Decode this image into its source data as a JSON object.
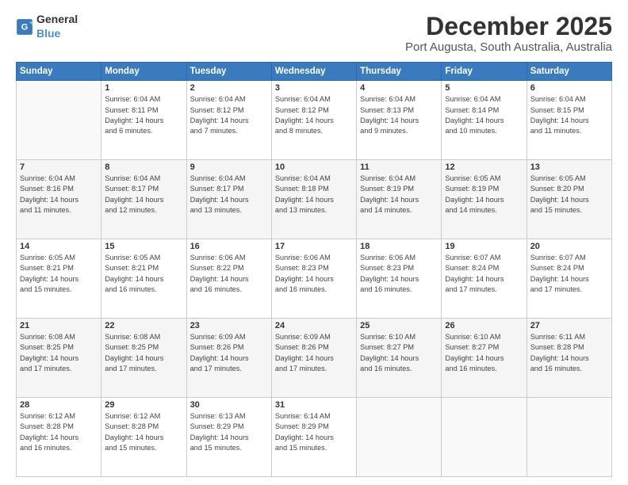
{
  "header": {
    "logo_general": "General",
    "logo_blue": "Blue",
    "main_title": "December 2025",
    "subtitle": "Port Augusta, South Australia, Australia"
  },
  "calendar": {
    "days_of_week": [
      "Sunday",
      "Monday",
      "Tuesday",
      "Wednesday",
      "Thursday",
      "Friday",
      "Saturday"
    ],
    "weeks": [
      [
        {
          "day": "",
          "info": ""
        },
        {
          "day": "1",
          "info": "Sunrise: 6:04 AM\nSunset: 8:11 PM\nDaylight: 14 hours\nand 6 minutes."
        },
        {
          "day": "2",
          "info": "Sunrise: 6:04 AM\nSunset: 8:12 PM\nDaylight: 14 hours\nand 7 minutes."
        },
        {
          "day": "3",
          "info": "Sunrise: 6:04 AM\nSunset: 8:12 PM\nDaylight: 14 hours\nand 8 minutes."
        },
        {
          "day": "4",
          "info": "Sunrise: 6:04 AM\nSunset: 8:13 PM\nDaylight: 14 hours\nand 9 minutes."
        },
        {
          "day": "5",
          "info": "Sunrise: 6:04 AM\nSunset: 8:14 PM\nDaylight: 14 hours\nand 10 minutes."
        },
        {
          "day": "6",
          "info": "Sunrise: 6:04 AM\nSunset: 8:15 PM\nDaylight: 14 hours\nand 11 minutes."
        }
      ],
      [
        {
          "day": "7",
          "info": "Sunrise: 6:04 AM\nSunset: 8:16 PM\nDaylight: 14 hours\nand 11 minutes."
        },
        {
          "day": "8",
          "info": "Sunrise: 6:04 AM\nSunset: 8:17 PM\nDaylight: 14 hours\nand 12 minutes."
        },
        {
          "day": "9",
          "info": "Sunrise: 6:04 AM\nSunset: 8:17 PM\nDaylight: 14 hours\nand 13 minutes."
        },
        {
          "day": "10",
          "info": "Sunrise: 6:04 AM\nSunset: 8:18 PM\nDaylight: 14 hours\nand 13 minutes."
        },
        {
          "day": "11",
          "info": "Sunrise: 6:04 AM\nSunset: 8:19 PM\nDaylight: 14 hours\nand 14 minutes."
        },
        {
          "day": "12",
          "info": "Sunrise: 6:05 AM\nSunset: 8:19 PM\nDaylight: 14 hours\nand 14 minutes."
        },
        {
          "day": "13",
          "info": "Sunrise: 6:05 AM\nSunset: 8:20 PM\nDaylight: 14 hours\nand 15 minutes."
        }
      ],
      [
        {
          "day": "14",
          "info": "Sunrise: 6:05 AM\nSunset: 8:21 PM\nDaylight: 14 hours\nand 15 minutes."
        },
        {
          "day": "15",
          "info": "Sunrise: 6:05 AM\nSunset: 8:21 PM\nDaylight: 14 hours\nand 16 minutes."
        },
        {
          "day": "16",
          "info": "Sunrise: 6:06 AM\nSunset: 8:22 PM\nDaylight: 14 hours\nand 16 minutes."
        },
        {
          "day": "17",
          "info": "Sunrise: 6:06 AM\nSunset: 8:23 PM\nDaylight: 14 hours\nand 16 minutes."
        },
        {
          "day": "18",
          "info": "Sunrise: 6:06 AM\nSunset: 8:23 PM\nDaylight: 14 hours\nand 16 minutes."
        },
        {
          "day": "19",
          "info": "Sunrise: 6:07 AM\nSunset: 8:24 PM\nDaylight: 14 hours\nand 17 minutes."
        },
        {
          "day": "20",
          "info": "Sunrise: 6:07 AM\nSunset: 8:24 PM\nDaylight: 14 hours\nand 17 minutes."
        }
      ],
      [
        {
          "day": "21",
          "info": "Sunrise: 6:08 AM\nSunset: 8:25 PM\nDaylight: 14 hours\nand 17 minutes."
        },
        {
          "day": "22",
          "info": "Sunrise: 6:08 AM\nSunset: 8:25 PM\nDaylight: 14 hours\nand 17 minutes."
        },
        {
          "day": "23",
          "info": "Sunrise: 6:09 AM\nSunset: 8:26 PM\nDaylight: 14 hours\nand 17 minutes."
        },
        {
          "day": "24",
          "info": "Sunrise: 6:09 AM\nSunset: 8:26 PM\nDaylight: 14 hours\nand 17 minutes."
        },
        {
          "day": "25",
          "info": "Sunrise: 6:10 AM\nSunset: 8:27 PM\nDaylight: 14 hours\nand 16 minutes."
        },
        {
          "day": "26",
          "info": "Sunrise: 6:10 AM\nSunset: 8:27 PM\nDaylight: 14 hours\nand 16 minutes."
        },
        {
          "day": "27",
          "info": "Sunrise: 6:11 AM\nSunset: 8:28 PM\nDaylight: 14 hours\nand 16 minutes."
        }
      ],
      [
        {
          "day": "28",
          "info": "Sunrise: 6:12 AM\nSunset: 8:28 PM\nDaylight: 14 hours\nand 16 minutes."
        },
        {
          "day": "29",
          "info": "Sunrise: 6:12 AM\nSunset: 8:28 PM\nDaylight: 14 hours\nand 15 minutes."
        },
        {
          "day": "30",
          "info": "Sunrise: 6:13 AM\nSunset: 8:29 PM\nDaylight: 14 hours\nand 15 minutes."
        },
        {
          "day": "31",
          "info": "Sunrise: 6:14 AM\nSunset: 8:29 PM\nDaylight: 14 hours\nand 15 minutes."
        },
        {
          "day": "",
          "info": ""
        },
        {
          "day": "",
          "info": ""
        },
        {
          "day": "",
          "info": ""
        }
      ]
    ]
  }
}
